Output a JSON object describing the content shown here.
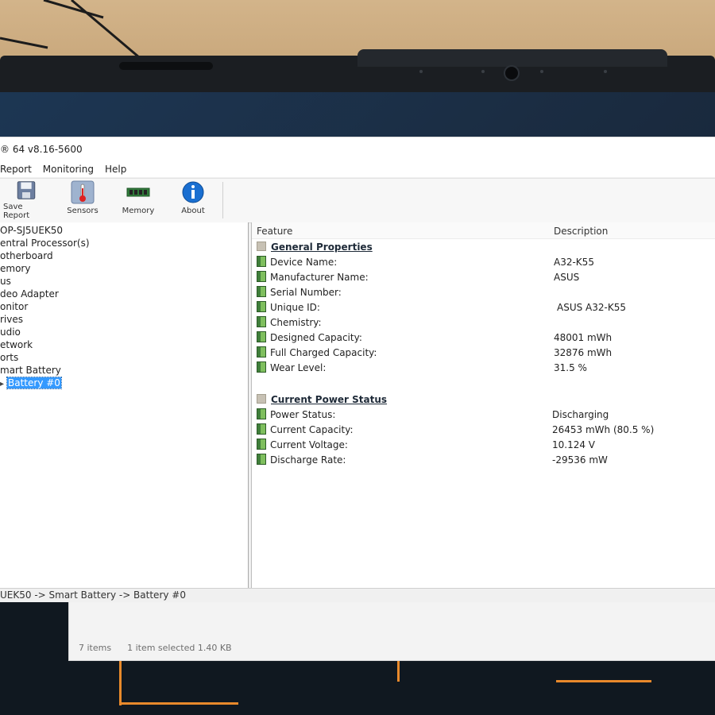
{
  "window": {
    "title": "® 64 v8.16-5600"
  },
  "menu": [
    "Report",
    "Monitoring",
    "Help"
  ],
  "toolbar": {
    "save_report": "Save Report",
    "sensors": "Sensors",
    "memory": "Memory",
    "about": "About"
  },
  "tree": {
    "items": [
      "OP-SJ5UEK50",
      "entral Processor(s)",
      "otherboard",
      "emory",
      "us",
      "deo Adapter",
      "onitor",
      "rives",
      "udio",
      "etwork",
      "orts",
      "mart Battery",
      "Battery #0"
    ],
    "selected": "Battery #0"
  },
  "details": {
    "col_feature": "Feature",
    "col_description": "Description",
    "general_title": "General Properties",
    "general": [
      {
        "key": "Device Name:",
        "value": "A32-K55"
      },
      {
        "key": "Manufacturer Name:",
        "value": "ASUS"
      },
      {
        "key": "Serial Number:",
        "value": ""
      },
      {
        "key": "Unique ID:",
        "value": "ASUS A32-K55"
      },
      {
        "key": "Chemistry:",
        "value": ""
      },
      {
        "key": "Designed Capacity:",
        "value": "48001 mWh"
      },
      {
        "key": "Full Charged Capacity:",
        "value": "32876 mWh"
      },
      {
        "key": "Wear Level:",
        "value": "31.5 %"
      }
    ],
    "power_title": "Current Power Status",
    "power": [
      {
        "key": "Power Status:",
        "value": "Discharging"
      },
      {
        "key": "Current Capacity:",
        "value": "26453 mWh (80.5 %)"
      },
      {
        "key": "Current Voltage:",
        "value": "10.124 V"
      },
      {
        "key": "Discharge Rate:",
        "value": "-29536 mW"
      }
    ]
  },
  "statusbar": {
    "path": "UEK50 -> Smart Battery -> Battery #0"
  },
  "explorer": {
    "items_count": "7 items",
    "selection": "1 item selected  1.40 KB"
  },
  "icons": {
    "save": "floppy-disk-icon",
    "sensors": "thermometer-icon",
    "memory": "memory-module-icon",
    "about": "info-icon",
    "section": "section-folder-icon",
    "leaf": "battery-leaf-icon"
  },
  "colors": {
    "selection": "#3399ff",
    "accent_orange": "#e8892b",
    "about_blue": "#1a6fd1"
  }
}
